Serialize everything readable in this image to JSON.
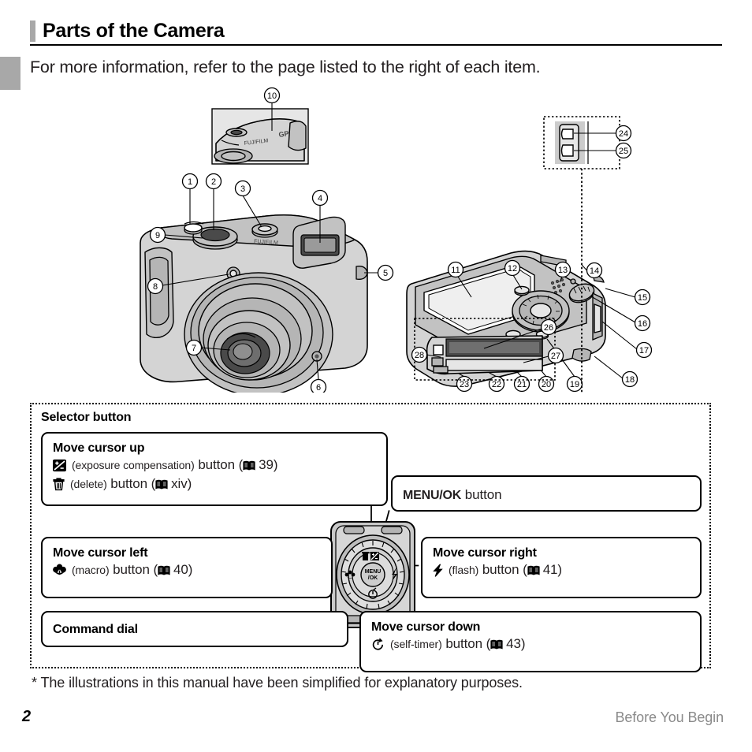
{
  "header": {
    "title": "Parts of the Camera",
    "subtitle": "For more information, refer to the page listed to the right of each item."
  },
  "illustration": {
    "top_detail_label": "GPS",
    "callouts_front": [
      "1",
      "2",
      "3",
      "4",
      "5",
      "6",
      "7",
      "8",
      "9"
    ],
    "callout_top_detail": "10",
    "callouts_rear": [
      "11",
      "12",
      "13",
      "14",
      "15",
      "16",
      "17",
      "18",
      "19",
      "20",
      "21",
      "22",
      "23"
    ],
    "callouts_connector": [
      "24",
      "25"
    ],
    "callouts_battery": [
      "26",
      "27",
      "28"
    ]
  },
  "selector": {
    "heading": "Selector button",
    "dial_center_line1": "MENU",
    "dial_center_line2": "/OK",
    "boxes": {
      "up": {
        "heading": "Move cursor up",
        "line1_icon": "exposure-compensation-icon",
        "line1_label": "(exposure compensation)",
        "line1_button": "button",
        "line1_page_icon": "book-icon",
        "line1_page": "39",
        "line2_icon": "delete-icon",
        "line2_label": "(delete)",
        "line2_button": "button",
        "line2_page_icon": "book-icon",
        "line2_page": "xiv"
      },
      "menu": {
        "bold": "MENU/OK",
        "rest": "button"
      },
      "left": {
        "heading": "Move cursor left",
        "icon": "macro-icon",
        "label": "(macro)",
        "button": "button",
        "page_icon": "book-icon",
        "page": "40"
      },
      "right": {
        "heading": "Move cursor right",
        "icon": "flash-icon",
        "label": "(flash)",
        "button": "button",
        "page_icon": "book-icon",
        "page": "41"
      },
      "command": {
        "heading": "Command dial"
      },
      "down": {
        "heading": "Move cursor down",
        "icon": "self-timer-icon",
        "label": "(self-timer)",
        "button": "button",
        "page_icon": "book-icon",
        "page": "43"
      }
    }
  },
  "footnote": "* The illustrations in this manual have been simplified for explanatory purposes.",
  "footer": {
    "page_number": "2",
    "section_label": "Before You Begin"
  },
  "colors": {
    "accent_gray": "#a8a8a8",
    "text": "#231f20",
    "footer_gray": "#8a8a8a",
    "camera_body": "#d4d4d4"
  }
}
